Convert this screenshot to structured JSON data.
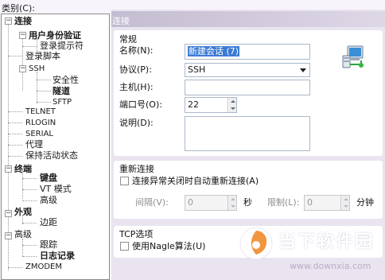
{
  "category_label": "类别(C):",
  "tree": {
    "items": [
      {
        "label": "连接"
      },
      {
        "label": "用户身份验证"
      },
      {
        "label": "登录提示符"
      },
      {
        "label": "登录脚本"
      },
      {
        "label": "SSH"
      },
      {
        "label": "安全性"
      },
      {
        "label": "隧道"
      },
      {
        "label": "SFTP"
      },
      {
        "label": "TELNET"
      },
      {
        "label": "RLOGIN"
      },
      {
        "label": "SERIAL"
      },
      {
        "label": "代理"
      },
      {
        "label": "保持活动状态"
      },
      {
        "label": "终端"
      },
      {
        "label": "键盘"
      },
      {
        "label": "VT 模式"
      },
      {
        "label": "高级"
      },
      {
        "label": "外观"
      },
      {
        "label": "边距"
      },
      {
        "label": "高级"
      },
      {
        "label": "跟踪"
      },
      {
        "label": "日志记录"
      },
      {
        "label": "ZMODEM"
      }
    ]
  },
  "panel": {
    "header": "连接",
    "general": {
      "title": "常规",
      "name_label": "名称(N):",
      "name_value": "新建会话 (7)",
      "protocol_label": "协议(P):",
      "protocol_value": "SSH",
      "host_label": "主机(H):",
      "host_value": "",
      "port_label": "端口号(O):",
      "port_value": "22",
      "description_label": "说明(D):",
      "description_value": ""
    },
    "reconnect": {
      "title": "重新连接",
      "auto_reconnect_label": "连接异常关闭时自动重新连接(A)",
      "interval_label": "间隔(V):",
      "interval_value": "0",
      "interval_unit": "秒",
      "limit_label": "限制(L):",
      "limit_value": "0",
      "limit_unit": "分钟"
    },
    "tcp": {
      "title": "TCP选项",
      "nagle_label": "使用Nagle算法(U)"
    }
  },
  "watermark": {
    "text": "当下软件园",
    "url": "www.downxia.com"
  }
}
